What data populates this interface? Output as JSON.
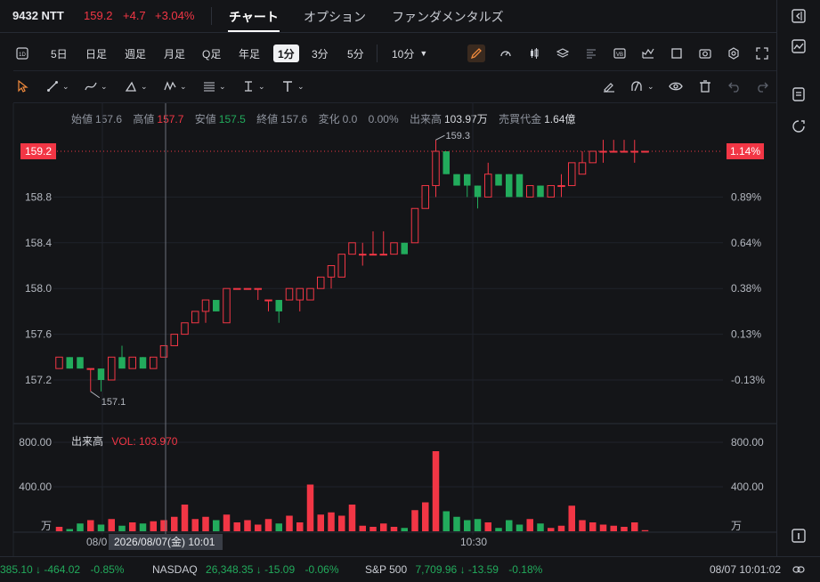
{
  "header": {
    "symbol": "9432 NTT",
    "price": "159.2",
    "change": "+4.7",
    "change_pct": "+3.04%",
    "tabs": [
      {
        "label": "チャート",
        "active": true
      },
      {
        "label": "オプション",
        "active": false
      },
      {
        "label": "ファンダメンタルズ",
        "active": false
      }
    ]
  },
  "toolbar": {
    "periods": [
      "5日",
      "日足",
      "週足",
      "月足",
      "Q足",
      "年足",
      "1分",
      "3分",
      "5分"
    ],
    "active_period": "1分",
    "interval_dropdown": "10分",
    "icons": [
      "1d-icon",
      "pencil-icon",
      "gauge-icon",
      "candle-type-icon",
      "layers-icon",
      "align-icon",
      "vb-icon",
      "indicator-icon",
      "square-icon",
      "camera-icon",
      "gear-icon",
      "fullscreen-icon"
    ]
  },
  "drawing_tools": [
    "cursor-icon",
    "line-tool-icon",
    "curve-tool-icon",
    "triangle-tool-icon",
    "wave-tool-icon",
    "fib-tool-icon",
    "text-cursor-icon",
    "text-tool-icon",
    "brush-icon",
    "magnet-icon",
    "eye-icon",
    "trash-icon",
    "undo-icon",
    "redo-icon"
  ],
  "ohlc": {
    "open_label": "始値",
    "open": "157.6",
    "high_label": "高値",
    "high": "157.7",
    "low_label": "安値",
    "low": "157.5",
    "close_label": "終値",
    "close": "157.6",
    "change_label": "変化",
    "change": "0.0",
    "change_pct": "0.00%",
    "volume_label": "出来高",
    "volume": "103.97万",
    "turnover_label": "売買代金",
    "turnover": "1.64億"
  },
  "volume_panel": {
    "label": "出来高",
    "vol_text": "VOL: 103.970",
    "axis_unit": "万"
  },
  "crosshair": {
    "time_label": "2026/08/07(金) 10:01"
  },
  "current_price_label": "159.2",
  "current_pct_label": "1.14%",
  "colors": {
    "up": "#f23645",
    "down": "#22ab5c",
    "background": "#141518",
    "accent": "#f08a3c"
  },
  "chart_data": {
    "type": "candlestick",
    "price_axis": {
      "ticks": [
        "157.2",
        "157.6",
        "158.0",
        "158.4",
        "158.8"
      ],
      "range": [
        157.0,
        159.4
      ]
    },
    "pct_axis": {
      "ticks": [
        "-0.13%",
        "0.13%",
        "0.38%",
        "0.64%",
        "0.89%"
      ]
    },
    "volume_axis": {
      "ticks": [
        "800.00",
        "400.00"
      ],
      "range": [
        0,
        800
      ]
    },
    "x_labels": [
      "08/0",
      "10:30"
    ],
    "annotations": [
      {
        "text": "159.3",
        "type": "high"
      },
      {
        "text": "157.1",
        "type": "low"
      }
    ],
    "candles": [
      {
        "o": 157.3,
        "h": 157.4,
        "l": 157.3,
        "c": 157.4,
        "v": 40
      },
      {
        "o": 157.4,
        "h": 157.4,
        "l": 157.3,
        "c": 157.3,
        "v": 20
      },
      {
        "o": 157.4,
        "h": 157.4,
        "l": 157.3,
        "c": 157.3,
        "v": 70
      },
      {
        "o": 157.3,
        "h": 157.3,
        "l": 157.1,
        "c": 157.3,
        "v": 100
      },
      {
        "o": 157.3,
        "h": 157.3,
        "l": 157.1,
        "c": 157.2,
        "v": 60
      },
      {
        "o": 157.2,
        "h": 157.4,
        "l": 157.2,
        "c": 157.4,
        "v": 110
      },
      {
        "o": 157.4,
        "h": 157.5,
        "l": 157.3,
        "c": 157.3,
        "v": 50
      },
      {
        "o": 157.3,
        "h": 157.4,
        "l": 157.3,
        "c": 157.4,
        "v": 80
      },
      {
        "o": 157.4,
        "h": 157.4,
        "l": 157.3,
        "c": 157.3,
        "v": 70
      },
      {
        "o": 157.3,
        "h": 157.4,
        "l": 157.3,
        "c": 157.4,
        "v": 90
      },
      {
        "o": 157.4,
        "h": 157.5,
        "l": 157.4,
        "c": 157.5,
        "v": 100
      },
      {
        "o": 157.5,
        "h": 157.6,
        "l": 157.5,
        "c": 157.6,
        "v": 130
      },
      {
        "o": 157.6,
        "h": 157.7,
        "l": 157.6,
        "c": 157.7,
        "v": 240
      },
      {
        "o": 157.7,
        "h": 157.8,
        "l": 157.7,
        "c": 157.8,
        "v": 110
      },
      {
        "o": 157.8,
        "h": 157.9,
        "l": 157.7,
        "c": 157.9,
        "v": 130
      },
      {
        "o": 157.9,
        "h": 157.9,
        "l": 157.8,
        "c": 157.8,
        "v": 100
      },
      {
        "o": 157.7,
        "h": 158.0,
        "l": 157.7,
        "c": 158.0,
        "v": 150
      },
      {
        "o": 158.0,
        "h": 158.0,
        "l": 158.0,
        "c": 158.0,
        "v": 80
      },
      {
        "o": 158.0,
        "h": 158.0,
        "l": 158.0,
        "c": 158.0,
        "v": 100
      },
      {
        "o": 158.0,
        "h": 158.0,
        "l": 157.9,
        "c": 158.0,
        "v": 60
      },
      {
        "o": 157.9,
        "h": 157.9,
        "l": 157.8,
        "c": 157.9,
        "v": 110
      },
      {
        "o": 157.9,
        "h": 157.9,
        "l": 157.7,
        "c": 157.8,
        "v": 70
      },
      {
        "o": 157.9,
        "h": 158.0,
        "l": 157.9,
        "c": 158.0,
        "v": 140
      },
      {
        "o": 157.9,
        "h": 158.0,
        "l": 157.8,
        "c": 158.0,
        "v": 80
      },
      {
        "o": 157.9,
        "h": 158.0,
        "l": 157.9,
        "c": 158.0,
        "v": 420
      },
      {
        "o": 158.0,
        "h": 158.1,
        "l": 158.0,
        "c": 158.1,
        "v": 150
      },
      {
        "o": 158.1,
        "h": 158.2,
        "l": 158.0,
        "c": 158.2,
        "v": 170
      },
      {
        "o": 158.1,
        "h": 158.3,
        "l": 158.1,
        "c": 158.3,
        "v": 140
      },
      {
        "o": 158.3,
        "h": 158.4,
        "l": 158.3,
        "c": 158.4,
        "v": 240
      },
      {
        "o": 158.3,
        "h": 158.4,
        "l": 158.2,
        "c": 158.3,
        "v": 50
      },
      {
        "o": 158.3,
        "h": 158.5,
        "l": 158.3,
        "c": 158.3,
        "v": 40
      },
      {
        "o": 158.3,
        "h": 158.5,
        "l": 158.3,
        "c": 158.3,
        "v": 70
      },
      {
        "o": 158.3,
        "h": 158.4,
        "l": 158.3,
        "c": 158.4,
        "v": 40
      },
      {
        "o": 158.4,
        "h": 158.4,
        "l": 158.3,
        "c": 158.3,
        "v": 30
      },
      {
        "o": 158.4,
        "h": 158.7,
        "l": 158.4,
        "c": 158.7,
        "v": 190
      },
      {
        "o": 158.7,
        "h": 158.9,
        "l": 158.7,
        "c": 158.9,
        "v": 260
      },
      {
        "o": 158.9,
        "h": 159.3,
        "l": 158.8,
        "c": 159.2,
        "v": 720
      },
      {
        "o": 159.2,
        "h": 159.2,
        "l": 159.0,
        "c": 159.0,
        "v": 180
      },
      {
        "o": 159.0,
        "h": 159.0,
        "l": 158.9,
        "c": 158.9,
        "v": 130
      },
      {
        "o": 159.0,
        "h": 159.0,
        "l": 158.8,
        "c": 158.9,
        "v": 100
      },
      {
        "o": 158.9,
        "h": 158.9,
        "l": 158.7,
        "c": 158.8,
        "v": 110
      },
      {
        "o": 158.8,
        "h": 159.1,
        "l": 158.8,
        "c": 159.0,
        "v": 80
      },
      {
        "o": 159.0,
        "h": 159.0,
        "l": 158.9,
        "c": 158.9,
        "v": 30
      },
      {
        "o": 159.0,
        "h": 159.0,
        "l": 158.8,
        "c": 158.8,
        "v": 100
      },
      {
        "o": 159.0,
        "h": 159.0,
        "l": 158.8,
        "c": 158.8,
        "v": 60
      },
      {
        "o": 158.8,
        "h": 158.9,
        "l": 158.8,
        "c": 158.9,
        "v": 110
      },
      {
        "o": 158.9,
        "h": 158.9,
        "l": 158.8,
        "c": 158.8,
        "v": 70
      },
      {
        "o": 158.8,
        "h": 158.9,
        "l": 158.8,
        "c": 158.9,
        "v": 30
      },
      {
        "o": 158.9,
        "h": 159.0,
        "l": 158.8,
        "c": 158.9,
        "v": 50
      },
      {
        "o": 158.9,
        "h": 159.1,
        "l": 158.9,
        "c": 159.1,
        "v": 230
      },
      {
        "o": 159.0,
        "h": 159.2,
        "l": 159.0,
        "c": 159.1,
        "v": 100
      },
      {
        "o": 159.1,
        "h": 159.2,
        "l": 159.1,
        "c": 159.2,
        "v": 80
      },
      {
        "o": 159.2,
        "h": 159.3,
        "l": 159.1,
        "c": 159.2,
        "v": 60
      },
      {
        "o": 159.2,
        "h": 159.3,
        "l": 159.2,
        "c": 159.2,
        "v": 50
      },
      {
        "o": 159.2,
        "h": 159.3,
        "l": 159.2,
        "c": 159.2,
        "v": 40
      },
      {
        "o": 159.2,
        "h": 159.3,
        "l": 159.1,
        "c": 159.2,
        "v": 80
      },
      {
        "o": 159.2,
        "h": 159.2,
        "l": 159.2,
        "c": 159.2,
        "v": 10
      }
    ]
  },
  "ticker": [
    {
      "value": "385.10",
      "arrow": "↓",
      "change": "-464.02",
      "pct": "-0.85%"
    },
    {
      "name": "NASDAQ",
      "value": "26,348.35",
      "arrow": "↓",
      "change": "-15.09",
      "pct": "-0.06%"
    },
    {
      "name": "S&P 500",
      "value": "7,709.96",
      "arrow": "↓",
      "change": "-13.59",
      "pct": "-0.18%"
    }
  ],
  "footer_time": "08/07 10:01:02"
}
